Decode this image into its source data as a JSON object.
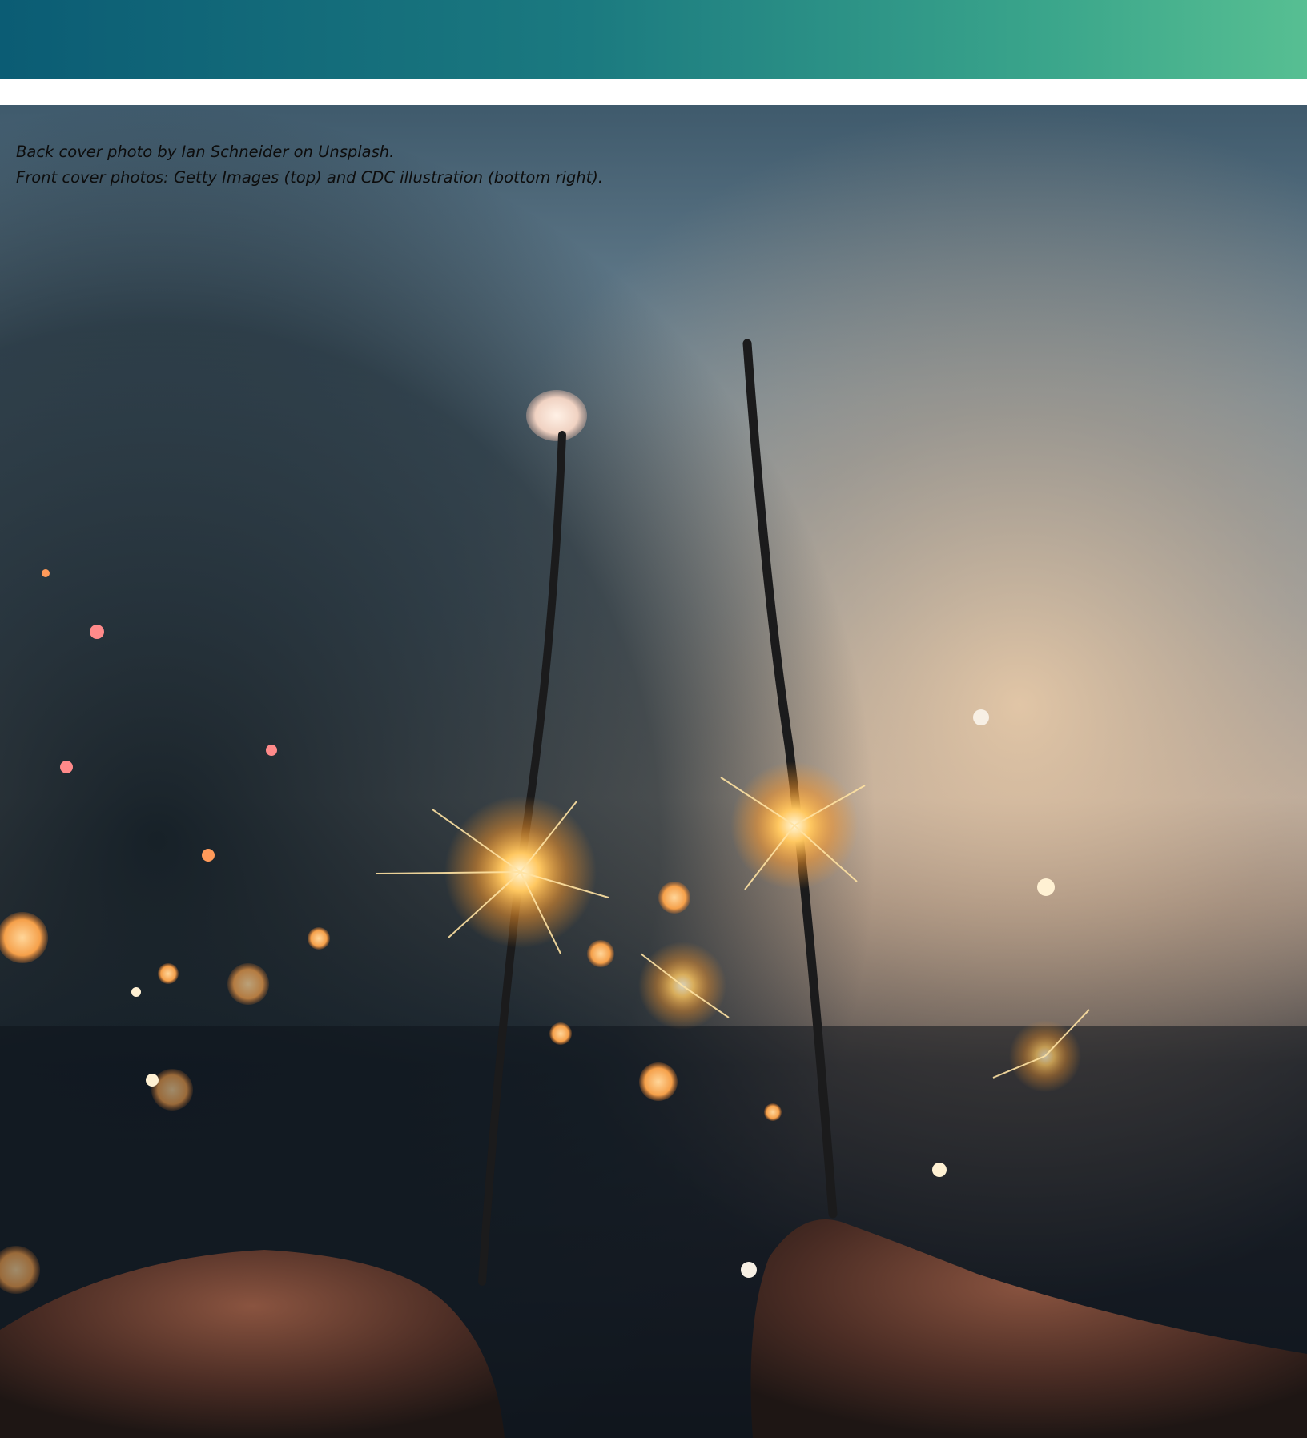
{
  "colors": {
    "header_gradient_start": "#0b5c74",
    "header_gradient_end": "#57bf92"
  },
  "photo": {
    "subject": "sparklers-photo"
  },
  "credits": {
    "line1": "Back cover photo by Ian Schneider on Unsplash.",
    "line2": "Front cover photos: Getty Images (top) and CDC illustration (bottom right)."
  }
}
